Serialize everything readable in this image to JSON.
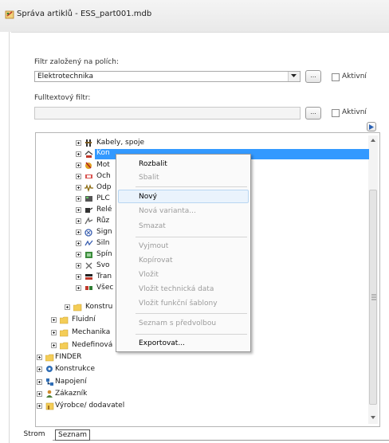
{
  "window": {
    "title": "Správa artiklů - ESS_part001.mdb"
  },
  "filter": {
    "label": "Filtr založený na polích:",
    "value": "Elektrotechnika",
    "browse_label": "...",
    "active_label": "Aktivní"
  },
  "fulltext": {
    "label": "Fulltextový filtr:",
    "value": "",
    "browse_label": "...",
    "active_label": "Aktivní"
  },
  "tree": {
    "items": [
      {
        "label": "Kabely, spoje",
        "icon": "cable-icon"
      },
      {
        "label": "Kon",
        "icon": "connector-icon",
        "selected": true
      },
      {
        "label": "Mot",
        "icon": "motor-icon"
      },
      {
        "label": "Och",
        "icon": "protection-icon"
      },
      {
        "label": "Odp",
        "icon": "resistor-icon"
      },
      {
        "label": "PLC",
        "icon": "plc-icon"
      },
      {
        "label": "Relé",
        "icon": "relay-icon"
      },
      {
        "label": "Růz",
        "icon": "misc-icon"
      },
      {
        "label": "Sign",
        "icon": "signal-icon"
      },
      {
        "label": "Siln",
        "icon": "power-icon"
      },
      {
        "label": "Spín",
        "icon": "switch-icon"
      },
      {
        "label": "Svo",
        "icon": "terminal-icon"
      },
      {
        "label": "Tran",
        "icon": "transformer-icon"
      },
      {
        "label": "Všec",
        "icon": "general-icon"
      },
      {
        "label": "Konstru",
        "icon": "folder-icon"
      },
      {
        "label": "Fluidní",
        "icon": "folder-icon"
      },
      {
        "label": "Mechanika",
        "icon": "folder-icon"
      },
      {
        "label": "Nedefinová",
        "icon": "folder-icon"
      },
      {
        "label": "FINDER",
        "icon": "folder-icon"
      },
      {
        "label": "Konstrukce",
        "icon": "construction-icon"
      },
      {
        "label": "Napojení",
        "icon": "connection-icon"
      },
      {
        "label": "Zákazník",
        "icon": "customer-icon"
      },
      {
        "label": "Výrobce/ dodavatel",
        "icon": "manufacturer-icon"
      }
    ]
  },
  "context_menu": {
    "items": [
      {
        "label": "Rozbalit",
        "enabled": true
      },
      {
        "label": "Sbalit",
        "enabled": false
      },
      {
        "label": "Nový",
        "enabled": true
      },
      {
        "label": "Nová varianta...",
        "enabled": false
      },
      {
        "label": "Smazat",
        "enabled": false
      },
      {
        "label": "Vyjmout",
        "enabled": false
      },
      {
        "label": "Kopírovat",
        "enabled": false
      },
      {
        "label": "Vložit",
        "enabled": false
      },
      {
        "label": "Vložit technická data",
        "enabled": false
      },
      {
        "label": "Vložit funkční šablony",
        "enabled": false
      },
      {
        "label": "Seznam s předvolbou",
        "enabled": false
      },
      {
        "label": "Exportovat...",
        "enabled": true
      }
    ]
  },
  "tabs": [
    {
      "label": "Strom",
      "active": true
    },
    {
      "label": "Seznam",
      "active": false
    }
  ],
  "colors": {
    "selection": "#3399ff",
    "hover": "#eaf3fc"
  }
}
